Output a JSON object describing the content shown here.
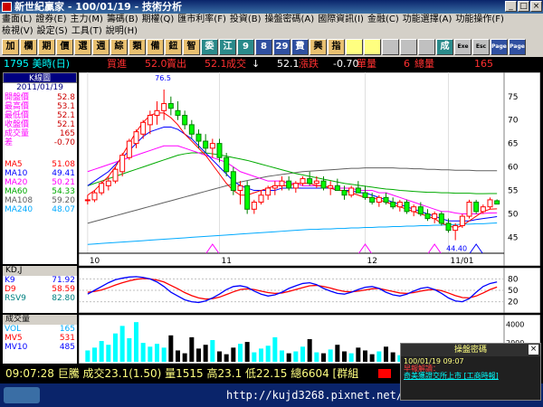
{
  "window": {
    "title": "新世紀贏家 - 100/01/19 - 技術分析"
  },
  "menu": {
    "row1": [
      "畫面(L)",
      "證券(E)",
      "主力(M)",
      "籌碼(B)",
      "期權(Q)",
      "匯市利率(F)",
      "投資(B)",
      "操盤密碼(A)",
      "國際資訊(I)",
      "金融(C)",
      "功能選擇(A)",
      "功能操作(F)"
    ],
    "row2": [
      "檢視(V)",
      "設定(S)",
      "工具(T)",
      "說明(H)"
    ]
  },
  "toolbar": {
    "buttons": [
      "加",
      "欄",
      "期",
      "價",
      "選",
      "週",
      "綜",
      "類",
      "備",
      "鈕",
      "智",
      "委",
      "江",
      "9",
      "8",
      "29",
      "費",
      "興",
      "指",
      "",
      "",
      "",
      "",
      "",
      "成",
      "Exe",
      "Esc",
      "Page",
      "Page"
    ]
  },
  "quote": {
    "code": "1795 美時(日)",
    "buy_label": "買進",
    "buy": "52.0",
    "sell_label": "賣出",
    "sell": "52.1",
    "last_label": "成交",
    "arrow": "↓",
    "last": "52.1",
    "change_label": "漲跌",
    "change": "-0.70",
    "vol_label": "單量",
    "vol": "6",
    "total_label": "總量",
    "total": "165"
  },
  "kpanel": {
    "title": "K線圖",
    "date": "2011/01/19",
    "rows": [
      {
        "label": "開盤價",
        "value": "52.8"
      },
      {
        "label": "最高價",
        "value": "53.1"
      },
      {
        "label": "最低價",
        "value": "52.1"
      },
      {
        "label": "收盤價",
        "value": "52.1"
      },
      {
        "label": "成交量",
        "value": "165"
      },
      {
        "label": "差",
        "value": "-0.70"
      }
    ],
    "ma": [
      {
        "label": "MA5",
        "value": "51.08",
        "color": "#ff0000"
      },
      {
        "label": "MA10",
        "value": "49.41",
        "color": "#0000ff"
      },
      {
        "label": "MA20",
        "value": "50.21",
        "color": "#ff00ff"
      },
      {
        "label": "MA60",
        "value": "54.33",
        "color": "#00aa00"
      },
      {
        "label": "MA108",
        "value": "59.20",
        "color": "#606060"
      },
      {
        "label": "MA240",
        "value": "48.07",
        "color": "#00aaff"
      }
    ]
  },
  "kd": {
    "title": "KD,J",
    "rows": [
      {
        "label": "K9",
        "value": "71.92",
        "color": "#0000ff"
      },
      {
        "label": "D9",
        "value": "58.59",
        "color": "#ff0000"
      },
      {
        "label": "RSV9",
        "value": "82.80",
        "color": "#008080"
      }
    ],
    "axis": [
      "80",
      "50",
      "20"
    ]
  },
  "volume": {
    "title": "成交量",
    "rows": [
      {
        "label": "VOL",
        "value": "165",
        "color": "#00aaff"
      },
      {
        "label": "MV5",
        "value": "531",
        "color": "#ff0000"
      },
      {
        "label": "MV10",
        "value": "485",
        "color": "#0000ff"
      }
    ],
    "axis": [
      "4000",
      "2000"
    ]
  },
  "chart_data": {
    "type": "candlestick",
    "price_axis": [
      "75",
      "70",
      "65",
      "60",
      "55",
      "50",
      "45"
    ],
    "ylim": [
      42,
      79
    ],
    "date_labels": [
      "10",
      "11",
      "12",
      "11/01"
    ],
    "annotations": [
      {
        "text": "76.5"
      },
      {
        "text": "44.40"
      }
    ],
    "candles": [
      [
        53,
        54,
        52,
        53
      ],
      [
        53,
        55,
        52.5,
        54.5
      ],
      [
        54.5,
        57,
        54,
        56.5
      ],
      [
        56,
        58,
        55,
        57
      ],
      [
        57,
        60,
        56.5,
        59.5
      ],
      [
        59,
        63,
        58,
        62.5
      ],
      [
        62,
        66,
        61.5,
        65.5
      ],
      [
        65,
        68,
        64,
        67.5
      ],
      [
        67,
        70,
        66,
        69.5
      ],
      [
        69,
        72,
        67,
        71
      ],
      [
        71,
        74,
        69,
        72
      ],
      [
        72,
        76.5,
        70,
        73.5
      ],
      [
        73.5,
        75,
        71,
        72.5
      ],
      [
        72,
        74,
        70,
        71
      ],
      [
        71,
        72,
        68,
        69
      ],
      [
        69,
        70,
        66,
        67
      ],
      [
        67,
        68,
        64,
        65.5
      ],
      [
        65.5,
        67,
        63,
        64
      ],
      [
        64,
        66,
        62,
        65
      ],
      [
        65,
        66,
        61,
        62
      ],
      [
        62,
        63,
        58,
        59
      ],
      [
        59,
        60,
        54,
        55
      ],
      [
        55,
        57,
        52,
        56
      ],
      [
        56,
        57,
        50,
        51
      ],
      [
        51,
        53,
        50,
        52.5
      ],
      [
        52.5,
        55,
        52,
        54
      ],
      [
        54,
        56,
        53,
        55.5
      ],
      [
        55.5,
        57,
        54,
        56
      ],
      [
        56,
        58,
        55,
        57
      ],
      [
        57,
        58,
        55,
        55.5
      ],
      [
        55.5,
        57,
        54.5,
        56.5
      ],
      [
        56.5,
        58,
        56,
        57.5
      ],
      [
        57.5,
        59,
        56,
        56.5
      ],
      [
        56.5,
        58,
        55.5,
        57
      ],
      [
        57,
        58,
        55,
        55.5
      ],
      [
        55.5,
        57,
        54,
        56
      ],
      [
        56,
        57.5,
        55,
        55
      ],
      [
        55,
        56,
        53,
        54
      ],
      [
        54,
        56,
        53.5,
        55.5
      ],
      [
        55.5,
        57,
        54.5,
        54.5
      ],
      [
        54.5,
        56,
        53,
        53.5
      ],
      [
        53.5,
        54.5,
        52,
        52.5
      ],
      [
        52.5,
        54,
        51.5,
        53.5
      ],
      [
        53.5,
        54.5,
        52,
        52.5
      ],
      [
        52.5,
        53.5,
        51,
        51.5
      ],
      [
        51.5,
        53,
        50.5,
        52.5
      ],
      [
        52.5,
        53,
        50,
        50.5
      ],
      [
        50.5,
        52,
        49.5,
        51.5
      ],
      [
        51.5,
        52.5,
        49.5,
        50
      ],
      [
        50,
        51,
        48.5,
        49
      ],
      [
        49,
        50.5,
        48,
        50
      ],
      [
        50,
        50.5,
        47.5,
        48
      ],
      [
        48,
        49,
        46,
        46.5
      ],
      [
        46.5,
        48,
        44.4,
        47.5
      ],
      [
        47.5,
        50,
        47,
        49.5
      ],
      [
        49.5,
        53,
        49,
        52.5
      ],
      [
        52.5,
        53,
        50,
        50.5
      ],
      [
        50.5,
        52,
        50,
        51.5
      ],
      [
        51.5,
        53.5,
        51,
        53
      ],
      [
        52.8,
        53.1,
        52.1,
        52.1
      ]
    ],
    "ma5": [
      54,
      55,
      56.5,
      58,
      60,
      62.5,
      65,
      67.5,
      69.5,
      71,
      71.5,
      71.5,
      70.5,
      69,
      67,
      65.5,
      64,
      62.5,
      60.5,
      58.5,
      56.5,
      55,
      54,
      54,
      54.5,
      55,
      55.5,
      56,
      56,
      56,
      56.5,
      56.5,
      56.5,
      56,
      56,
      55.5,
      55,
      55,
      54.5,
      54,
      53.5,
      53.5,
      53,
      52.5,
      52,
      51.5,
      51,
      50.5,
      50,
      49.5,
      49,
      48,
      47.5,
      47,
      47.5,
      48.5,
      49.5,
      50.5,
      51,
      51.08
    ],
    "ma10": [
      56,
      57,
      58,
      59,
      60.5,
      62,
      63.5,
      65,
      66.5,
      67.5,
      68,
      68.5,
      68.5,
      68,
      67,
      66,
      64.5,
      63,
      61.5,
      60,
      58.5,
      57,
      56,
      55.5,
      55,
      55,
      55,
      55,
      55.5,
      55.5,
      55.5,
      55.5,
      55.5,
      55.5,
      55.5,
      55.5,
      55,
      55,
      55,
      54.5,
      54.5,
      54,
      53.5,
      53,
      52.5,
      52,
      51.5,
      51,
      50.5,
      50,
      49.5,
      49,
      48.5,
      48.5,
      48.5,
      48.5,
      48.8,
      49,
      49.2,
      49.41
    ],
    "ma20": [
      59,
      59.5,
      60,
      60.5,
      61,
      61.5,
      62,
      62.5,
      63,
      63.5,
      64,
      64.5,
      64.5,
      64.5,
      64,
      63.5,
      63,
      62.5,
      62,
      61.5,
      61,
      60,
      59,
      58.5,
      58,
      57.5,
      57,
      57,
      57,
      56.5,
      56.5,
      56,
      56,
      56,
      56,
      55.5,
      55.5,
      55.5,
      55.5,
      55,
      55,
      55,
      54.5,
      54.5,
      54,
      53.5,
      53,
      52.5,
      52,
      51.5,
      51,
      50.5,
      50.5,
      50.2,
      50,
      50,
      50,
      50.1,
      50.2,
      50.21
    ],
    "ma60": [
      56,
      56.5,
      57,
      57.5,
      58,
      58.5,
      59,
      59.5,
      60,
      60.5,
      61,
      61.5,
      62,
      62.5,
      62.8,
      63,
      63,
      63,
      62.8,
      62.6,
      62.3,
      62,
      61.7,
      61.4,
      61,
      60.6,
      60.2,
      59.8,
      59.4,
      59,
      58.6,
      58.3,
      58,
      57.7,
      57.4,
      57.1,
      56.8,
      56.5,
      56.3,
      56.1,
      55.9,
      55.7,
      55.5,
      55.3,
      55.2,
      55,
      54.9,
      54.8,
      54.7,
      54.6,
      54.6,
      54.5,
      54.5,
      54.4,
      54.4,
      54.4,
      54.3,
      54.3,
      54.33,
      54.33
    ],
    "ma108": [
      48,
      48.4,
      48.8,
      49.2,
      49.6,
      50,
      50.4,
      50.8,
      51.2,
      51.6,
      52,
      52.4,
      52.8,
      53.2,
      53.6,
      54,
      54.4,
      54.8,
      55.2,
      55.6,
      56,
      56.4,
      56.8,
      57.1,
      57.4,
      57.7,
      58,
      58.2,
      58.4,
      58.6,
      58.8,
      59,
      59.1,
      59.2,
      59.3,
      59.4,
      59.5,
      59.6,
      59.7,
      59.7,
      59.8,
      59.8,
      59.8,
      59.8,
      59.8,
      59.7,
      59.7,
      59.6,
      59.6,
      59.5,
      59.5,
      59.4,
      59.4,
      59.3,
      59.3,
      59.3,
      59.2,
      59.2,
      59.2,
      59.2
    ],
    "ma240": [
      43.5,
      43.6,
      43.7,
      43.8,
      43.9,
      44,
      44.1,
      44.2,
      44.3,
      44.4,
      44.5,
      44.6,
      44.7,
      44.8,
      44.9,
      45,
      45.1,
      45.2,
      45.3,
      45.4,
      45.5,
      45.6,
      45.7,
      45.8,
      45.9,
      46,
      46.1,
      46.2,
      46.3,
      46.4,
      46.5,
      46.6,
      46.7,
      46.7,
      46.8,
      46.8,
      46.9,
      46.9,
      47,
      47,
      47.1,
      47.1,
      47.2,
      47.2,
      47.3,
      47.3,
      47.4,
      47.4,
      47.5,
      47.5,
      47.6,
      47.6,
      47.7,
      47.7,
      47.8,
      47.8,
      47.9,
      47.9,
      48,
      48.07
    ],
    "k": [
      40,
      50,
      60,
      70,
      78,
      82,
      85,
      86,
      84,
      80,
      72,
      60,
      45,
      35,
      25,
      20,
      18,
      22,
      30,
      40,
      52,
      60,
      62,
      58,
      48,
      40,
      35,
      38,
      45,
      55,
      62,
      68,
      70,
      65,
      55,
      48,
      42,
      40,
      45,
      52,
      58,
      60,
      55,
      45,
      38,
      35,
      40,
      48,
      55,
      58,
      52,
      42,
      30,
      22,
      20,
      28,
      45,
      60,
      68,
      71.92
    ],
    "d": [
      45,
      47,
      51,
      57,
      64,
      70,
      75,
      79,
      81,
      80,
      77,
      72,
      63,
      54,
      44,
      36,
      30,
      27,
      28,
      32,
      39,
      46,
      52,
      54,
      52,
      48,
      44,
      42,
      43,
      47,
      52,
      57,
      62,
      63,
      60,
      56,
      51,
      47,
      46,
      48,
      51,
      54,
      55,
      51,
      47,
      43,
      42,
      44,
      48,
      51,
      52,
      49,
      43,
      36,
      31,
      30,
      35,
      43,
      52,
      58.59
    ],
    "vol": [
      1200,
      1500,
      2200,
      1800,
      3000,
      3800,
      2500,
      4200,
      2000,
      1600,
      1900,
      1500,
      2800,
      1200,
      900,
      2600,
      1400,
      1800,
      2300,
      1100,
      800,
      1500,
      1900,
      2100,
      1000,
      1400,
      1700,
      2600,
      1200,
      900,
      1100,
      1600,
      2400,
      1000,
      900,
      1300,
      1800,
      1100,
      900,
      1500,
      1200,
      800,
      1100,
      1600,
      1000,
      700,
      1300,
      1500,
      900,
      600,
      1200,
      1800,
      800,
      1400,
      1000,
      600,
      700,
      900,
      500,
      165
    ]
  },
  "status": {
    "text": "09:07:28 巨騰 成交23.1(1.50) 量1515 高23.1 低22.15 總6604 [群組"
  },
  "popup": {
    "title": "操盤密碼",
    "line1": "100/01/19  09:07",
    "line2": "早報解讀：",
    "line3": "奇美獲證交所上市 [工商時報]"
  },
  "watermark": "http://kujd3268.pixnet.net/album"
}
